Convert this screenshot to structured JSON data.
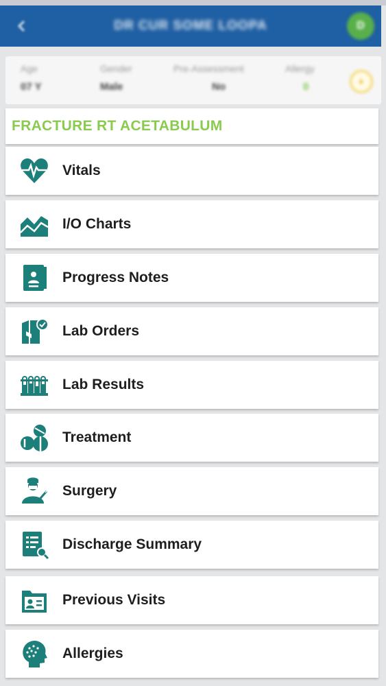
{
  "colors": {
    "app_bar": "#1f5fa3",
    "icon_teal": "#1d7f7a",
    "diagnosis_green": "#8acb4f"
  },
  "header": {
    "back_icon": "back-arrow-icon",
    "title": "DR CUR SOME LOOPA",
    "avatar_initial": "D"
  },
  "patient_info": {
    "age": {
      "label": "Age",
      "value": "07 Y"
    },
    "gender": {
      "label": "Gender",
      "value": "Male"
    },
    "pre_assessment": {
      "label": "Pre-Assessment",
      "value": "No"
    },
    "allergy": {
      "label": "Allergy",
      "value": "0"
    },
    "expand_icon": "chevron-right-icon"
  },
  "diagnosis": "FRACTURE RT ACETABULUM",
  "menu": [
    {
      "label": "Vitals",
      "icon": "heart-pulse-icon"
    },
    {
      "label": "I/O Charts",
      "icon": "area-chart-icon"
    },
    {
      "label": "Progress Notes",
      "icon": "notebook-icon"
    },
    {
      "label": "Lab Orders",
      "icon": "lab-order-icon"
    },
    {
      "label": "Lab Results",
      "icon": "test-tubes-icon"
    },
    {
      "label": "Treatment",
      "icon": "pills-icon"
    },
    {
      "label": "Surgery",
      "icon": "surgeon-icon"
    },
    {
      "label": "Discharge Summary",
      "icon": "document-check-icon"
    },
    {
      "label": "Previous Visits",
      "icon": "patient-file-icon"
    },
    {
      "label": "Allergies",
      "icon": "head-profile-icon"
    }
  ]
}
